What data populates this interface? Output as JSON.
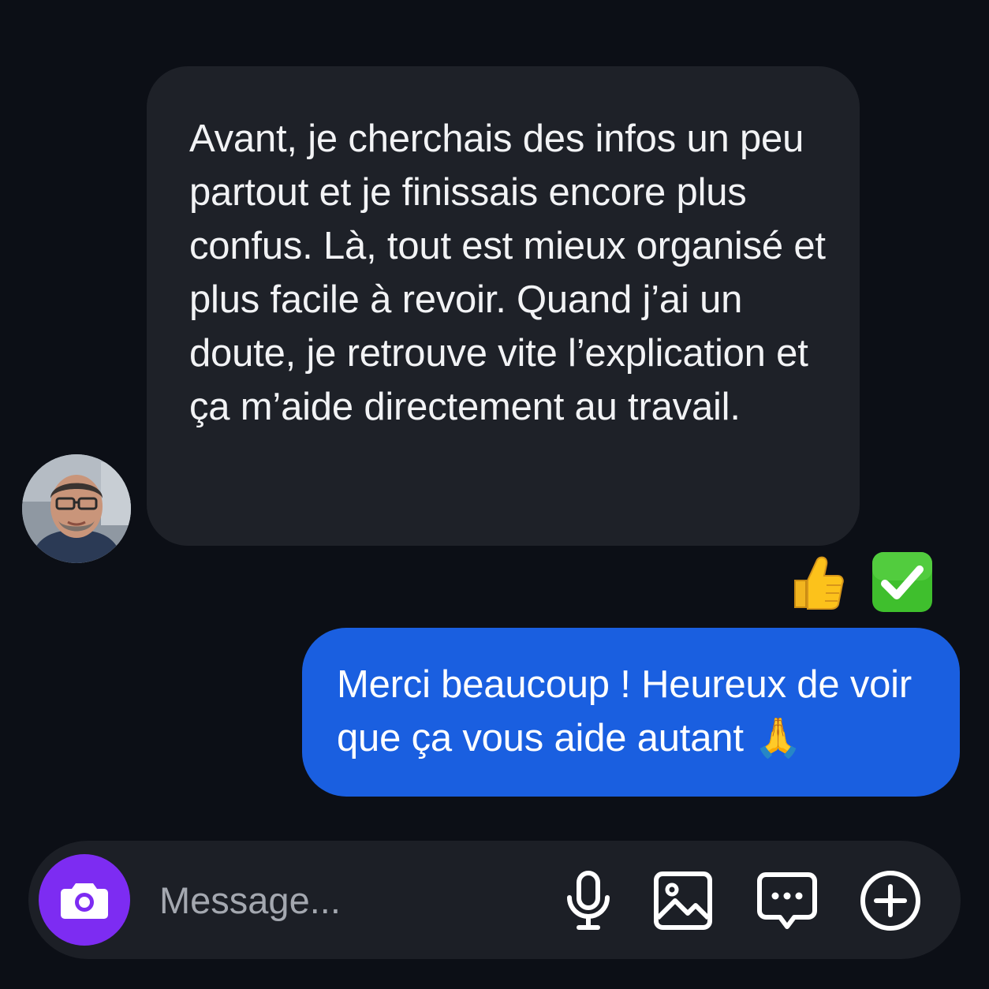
{
  "conversation": {
    "incoming": {
      "text": "Avant, je cherchais des infos un peu partout et je finissais encore plus confus. Là, tout est mieux organisé et plus facile à revoir. Quand j’ai un doute, je retrouve vite l’explication et ça m’aide directement au travail.",
      "reactions": [
        {
          "icon": "thumbs-up-icon",
          "glyph": "👍"
        },
        {
          "icon": "check-mark-button-icon",
          "glyph": "✅"
        }
      ]
    },
    "outgoing": {
      "text": "Merci beaucoup ! Heureux de voir que ça vous aide autant 🙏"
    }
  },
  "composer": {
    "placeholder": "Message...",
    "icons": [
      "camera-icon",
      "microphone-icon",
      "image-icon",
      "message-dots-icon",
      "plus-circle-icon"
    ]
  },
  "colors": {
    "background": "#0c0f16",
    "incoming_bubble": "#1e2128",
    "outgoing_bubble": "#1a5fe0",
    "camera_button": "#7d2cf2",
    "composer": "#1c1f26"
  }
}
